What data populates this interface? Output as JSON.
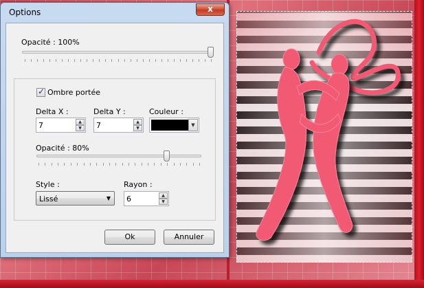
{
  "window": {
    "title": "Options",
    "close_label": "x"
  },
  "opacity_top": {
    "label": "Opacité : 100%",
    "value_percent": 100
  },
  "shadow": {
    "checkbox_label": "Ombre portée",
    "checked": true,
    "delta_x": {
      "label": "Delta X :",
      "value": "7"
    },
    "delta_y": {
      "label": "Delta Y :",
      "value": "7"
    },
    "color": {
      "label": "Couleur :",
      "value": "#000000"
    },
    "opacity": {
      "label": "Opacité : 80%",
      "value_percent": 80
    },
    "style": {
      "label": "Style :",
      "value": "Lissé"
    },
    "radius": {
      "label": "Rayon :",
      "value": "6"
    }
  },
  "buttons": {
    "ok": "Ok",
    "cancel": "Annuler"
  },
  "icons": {
    "spin_up": "up-arrow-icon",
    "spin_down": "down-arrow-icon",
    "dropdown": "chevron-down-icon"
  },
  "colors": {
    "figure": "#f25a73",
    "frame": "#b82030"
  }
}
